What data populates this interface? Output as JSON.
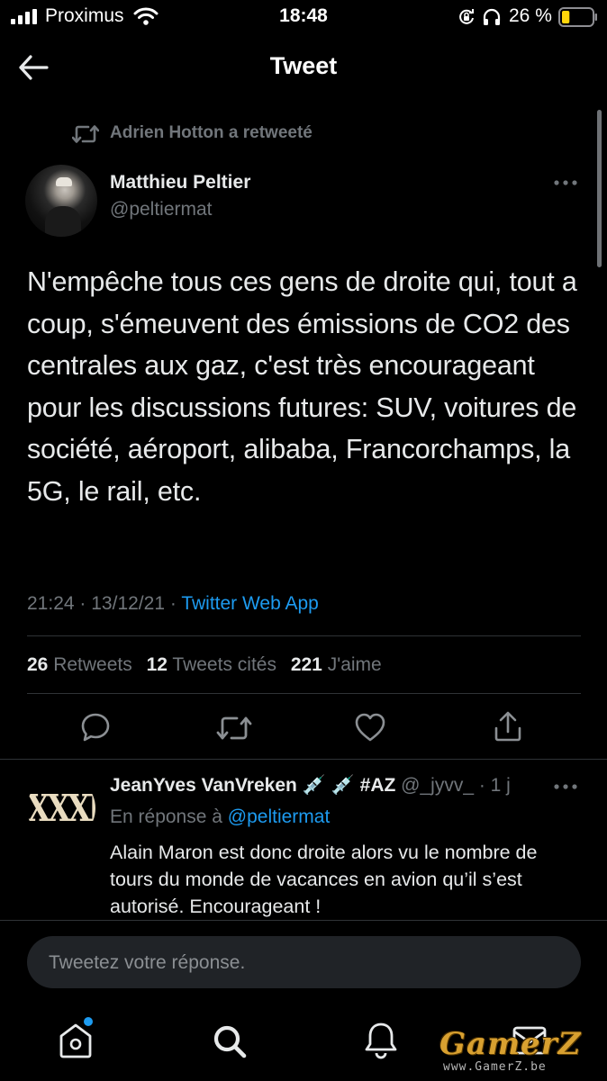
{
  "status_bar": {
    "carrier": "Proximus",
    "time": "18:48",
    "battery_percent": "26 %",
    "battery_level": 0.26
  },
  "header": {
    "title": "Tweet"
  },
  "retweet_context": {
    "text": "Adrien Hotton a retweeté"
  },
  "tweet": {
    "author_name": "Matthieu Peltier",
    "author_handle": "@peltiermat",
    "text": "N'empêche tous ces gens de droite qui, tout a coup, s'émeuvent des émissions de CO2 des centrales aux gaz, c'est très encourageant pour les discussions futures: SUV, voitures de société, aéroport, alibaba, Francorchamps, la 5G, le rail, etc.",
    "time": "21:24",
    "date": "13/12/21",
    "separator": "·",
    "source": "Twitter Web App"
  },
  "stats": {
    "retweets_count": "26",
    "retweets_label": "Retweets",
    "quotes_count": "12",
    "quotes_label": "Tweets cités",
    "likes_count": "221",
    "likes_label": "J'aime"
  },
  "reply": {
    "author_name": "JeanYves VanVreken",
    "badges": "💉 💉 #AZ",
    "author_handle": "@_jyvv_",
    "age": "· 1 j",
    "avatar_text": "XXXI",
    "in_reply_prefix": "En réponse à",
    "in_reply_handle": "@peltiermat",
    "text": "Alain Maron est donc droite alors vu le nombre de tours du monde de vacances en avion qu’il s’est autorisé. Encourageant !"
  },
  "composer": {
    "placeholder": "Tweetez votre réponse."
  },
  "colors": {
    "background": "#000000",
    "text": "#e7e9ea",
    "muted": "#71767b",
    "link": "#1d9bf0",
    "battery": "#ffd60a",
    "notification_dot": "#1d9bf0"
  },
  "icons": {
    "back": "arrow-left-icon",
    "more": "more-horizontal-icon",
    "reply": "comment-icon",
    "retweet": "retweet-icon",
    "like": "heart-icon",
    "share": "share-icon",
    "home": "home-icon",
    "search": "search-icon",
    "notifications": "bell-icon",
    "messages": "mail-icon"
  },
  "watermark": {
    "text": "GamerZ",
    "subtext": "www.GamerZ.be"
  }
}
